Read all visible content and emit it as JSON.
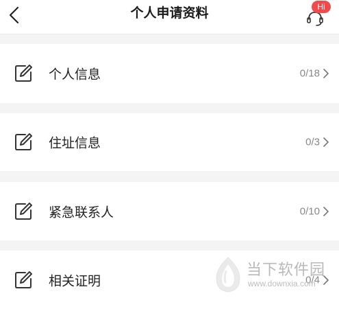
{
  "header": {
    "title": "个人申请资料",
    "back_icon": "chevron-left-icon",
    "customer_service": {
      "badge": "Hi",
      "icon": "headset-icon",
      "badge_color": "#f04a4a"
    }
  },
  "items": [
    {
      "label": "个人信息",
      "count": "0/18",
      "icon": "edit-icon"
    },
    {
      "label": "住址信息",
      "count": "0/3",
      "icon": "edit-icon"
    },
    {
      "label": "紧急联系人",
      "count": "0/10",
      "icon": "edit-icon"
    },
    {
      "label": "相关证明",
      "count": "0/4",
      "icon": "edit-icon"
    }
  ],
  "watermark": {
    "text": "当下软件园",
    "url": "www.downxia.com"
  },
  "colors": {
    "background": "#ffffff",
    "separator": "#f4f4f4",
    "text": "#222222",
    "muted": "#888888",
    "accent": "#f04a4a"
  }
}
